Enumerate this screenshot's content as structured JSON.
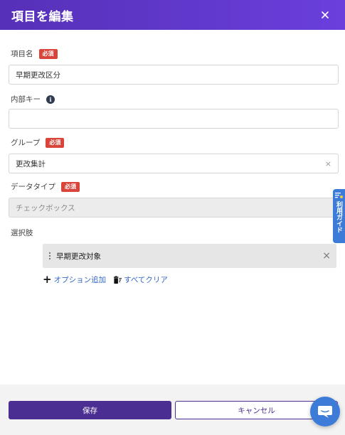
{
  "dialog": {
    "title": "項目を編集",
    "close_label": "×"
  },
  "fields": {
    "item_name": {
      "label": "項目名",
      "required_badge": "必須",
      "value": "早期更改区分"
    },
    "internal_key": {
      "label": "内部キー",
      "info_icon": "i",
      "value": ""
    },
    "group": {
      "label": "グループ",
      "required_badge": "必須",
      "value": "更改集計",
      "clear_label": "×"
    },
    "data_type": {
      "label": "データタイプ",
      "required_badge": "必須",
      "value": "チェックボックス"
    },
    "options": {
      "label": "選択肢",
      "items": [
        {
          "label": "早期更改対象",
          "remove_label": "×"
        }
      ],
      "add_option_label": "オプション追加",
      "clear_all_label": "すべてクリア"
    }
  },
  "footer": {
    "save_label": "保存",
    "cancel_label": "キャンセル"
  },
  "side_tab": {
    "label": "利用ガイド"
  },
  "colors": {
    "header_start": "#5630b8",
    "header_end": "#6a3fdc",
    "required_badge": "#d9453b",
    "primary_button": "#4b2e91",
    "link": "#3466c9",
    "guide_tab": "#3c7bd8"
  }
}
